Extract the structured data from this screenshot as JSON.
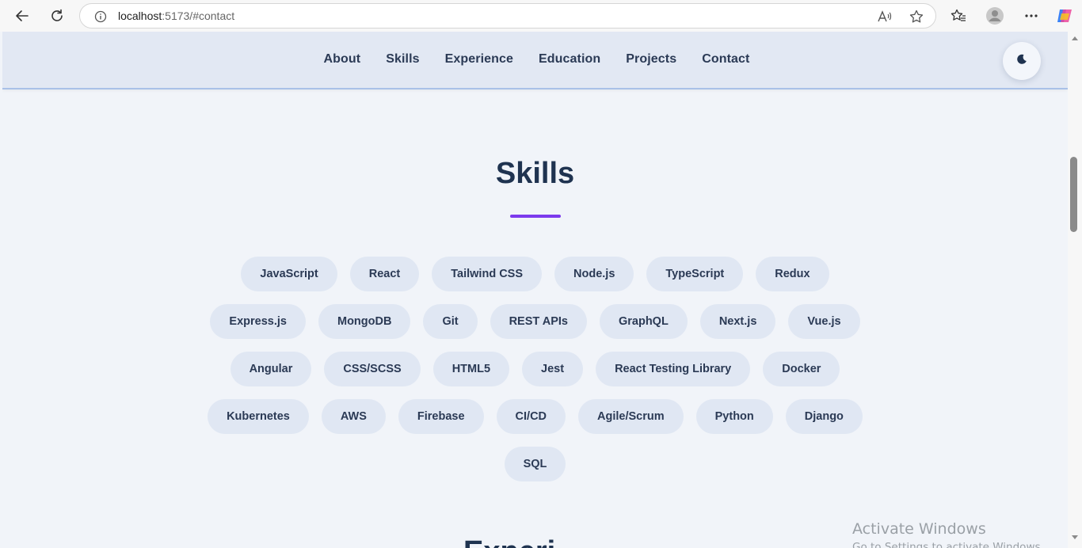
{
  "browser": {
    "url_host": "localhost",
    "url_rest": ":5173/#contact"
  },
  "nav": {
    "items": [
      {
        "label": "About"
      },
      {
        "label": "Skills"
      },
      {
        "label": "Experience"
      },
      {
        "label": "Education"
      },
      {
        "label": "Projects"
      },
      {
        "label": "Contact"
      }
    ]
  },
  "skills": {
    "title": "Skills",
    "items": [
      "JavaScript",
      "React",
      "Tailwind CSS",
      "Node.js",
      "TypeScript",
      "Redux",
      "Express.js",
      "MongoDB",
      "Git",
      "REST APIs",
      "GraphQL",
      "Next.js",
      "Vue.js",
      "Angular",
      "CSS/SCSS",
      "HTML5",
      "Jest",
      "React Testing Library",
      "Docker",
      "Kubernetes",
      "AWS",
      "Firebase",
      "CI/CD",
      "Agile/Scrum",
      "Python",
      "Django",
      "SQL"
    ]
  },
  "next_section": {
    "title_partial": "Experi"
  },
  "watermark": {
    "line1": "Activate Windows",
    "line2": "Go to Settings to activate Windows."
  },
  "colors": {
    "accent": "#7c3aed",
    "header_bg": "#e2e8f3",
    "page_bg": "#f1f4f9",
    "pill_bg": "#e0e7f3",
    "text_dark": "#1f3350"
  }
}
